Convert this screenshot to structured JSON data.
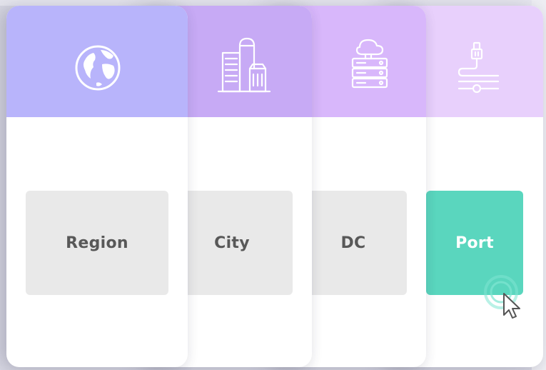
{
  "cards": [
    {
      "id": "region",
      "label": "Region",
      "icon": "globe-icon",
      "header_color": "#b8b4fb"
    },
    {
      "id": "city",
      "label": "City",
      "icon": "city-buildings-icon",
      "header_color": "#c7aaf5"
    },
    {
      "id": "dc",
      "label": "DC",
      "icon": "server-rack-cloud-icon",
      "header_color": "#d8b7fb"
    },
    {
      "id": "port",
      "label": "Port",
      "icon": "port-connector-icon",
      "header_color": "#e8d0fc",
      "accent_color": "#5ad6be"
    }
  ],
  "pointer": {
    "icon": "cursor-click-icon"
  }
}
